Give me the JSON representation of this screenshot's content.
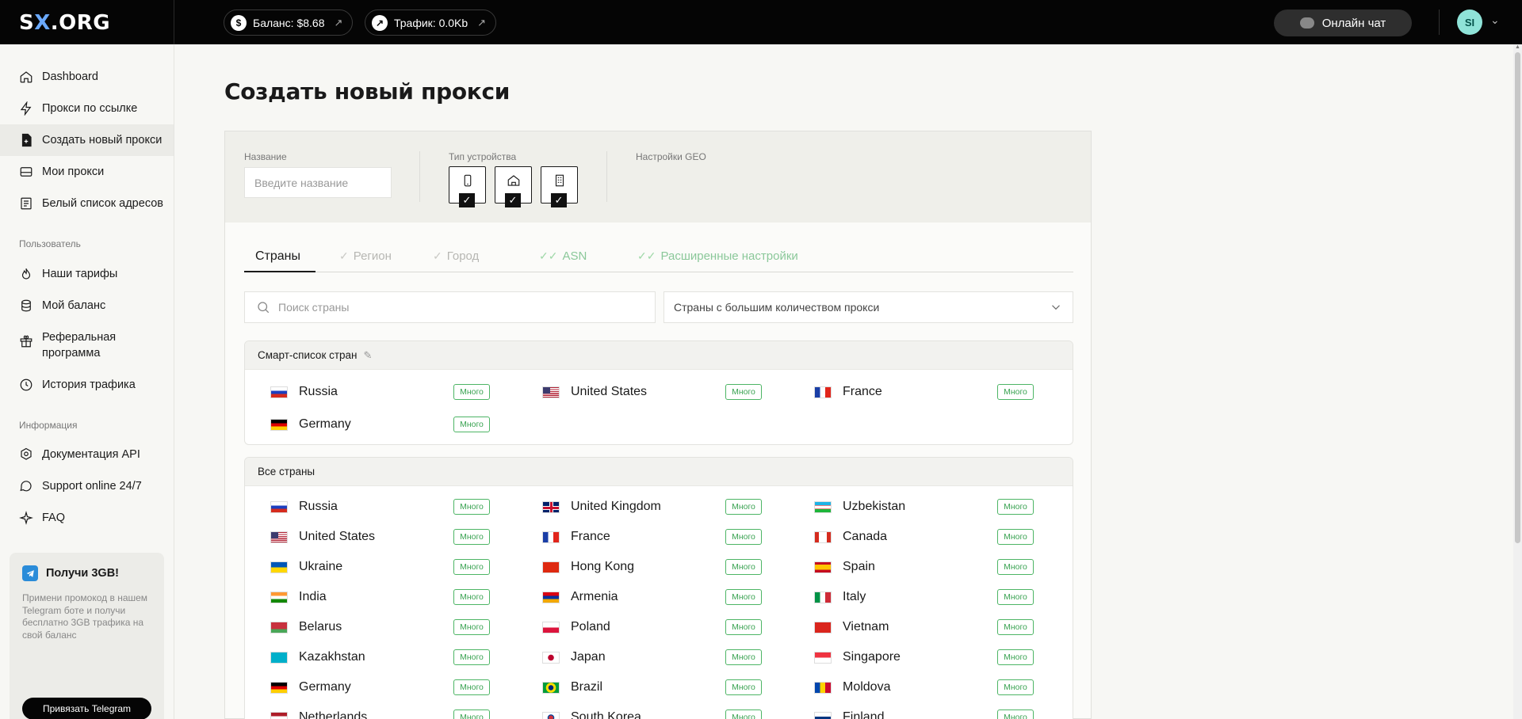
{
  "header": {
    "logo_pre": "S",
    "logo_x": "X",
    "logo_post": ".ORG",
    "balance": "Баланс: $8.68",
    "traffic": "Трафик: 0.0Kb",
    "chat": "Онлайн чат",
    "avatar": "SI"
  },
  "sidebar": {
    "items": [
      {
        "label": "Dashboard",
        "icon": "home-icon"
      },
      {
        "label": "Прокси по ссылке",
        "icon": "lightning-icon"
      },
      {
        "label": "Создать новый прокси",
        "icon": "file-plus-icon"
      },
      {
        "label": "Мои прокси",
        "icon": "drive-icon"
      },
      {
        "label": "Белый список адресов",
        "icon": "list-icon"
      }
    ],
    "section_user": "Пользователь",
    "user_items": [
      {
        "label": "Наши тарифы",
        "icon": "flame-icon"
      },
      {
        "label": "Мой баланс",
        "icon": "coins-icon"
      },
      {
        "label": "Реферальная программа",
        "icon": "gift-icon"
      },
      {
        "label": "История трафика",
        "icon": "clock-icon"
      }
    ],
    "section_info": "Информация",
    "info_items": [
      {
        "label": "Документация API",
        "icon": "settings-icon"
      },
      {
        "label": "Support online 24/7",
        "icon": "chat-icon"
      },
      {
        "label": "FAQ",
        "icon": "sparkle-icon"
      }
    ],
    "promo": {
      "title": "Получи 3GB!",
      "text": "Примени промокод в нашем Telegram боте и получи бесплатно 3GB трафика на свой баланс",
      "button": "Привязать Telegram"
    }
  },
  "main": {
    "title": "Создать новый прокси",
    "name_label": "Название",
    "name_placeholder": "Введите название",
    "device_label": "Тип устройства",
    "geo_label": "Настройки GEO",
    "tabs": [
      "Страны",
      "Регион",
      "Город",
      "ASN",
      "Расширенные настройки"
    ],
    "search_placeholder": "Поиск страны",
    "sort_value": "Страны с большим количеством прокси",
    "smart_title": "Смарт-список стран",
    "all_title": "Все страны",
    "badge": "Много",
    "smart_countries": [
      "Russia",
      "United States",
      "France",
      "Germany"
    ],
    "all_countries": [
      "Russia",
      "United Kingdom",
      "Uzbekistan",
      "United States",
      "France",
      "Canada",
      "Ukraine",
      "Hong Kong",
      "Spain",
      "India",
      "Armenia",
      "Italy",
      "Belarus",
      "Poland",
      "Vietnam",
      "Kazakhstan",
      "Japan",
      "Singapore",
      "Germany",
      "Brazil",
      "Moldova",
      "Netherlands",
      "South Korea",
      "Finland"
    ]
  },
  "colors": {
    "accent_green": "#3aa352",
    "topbar": "#050505",
    "logo_x": "#6aa9ff"
  }
}
